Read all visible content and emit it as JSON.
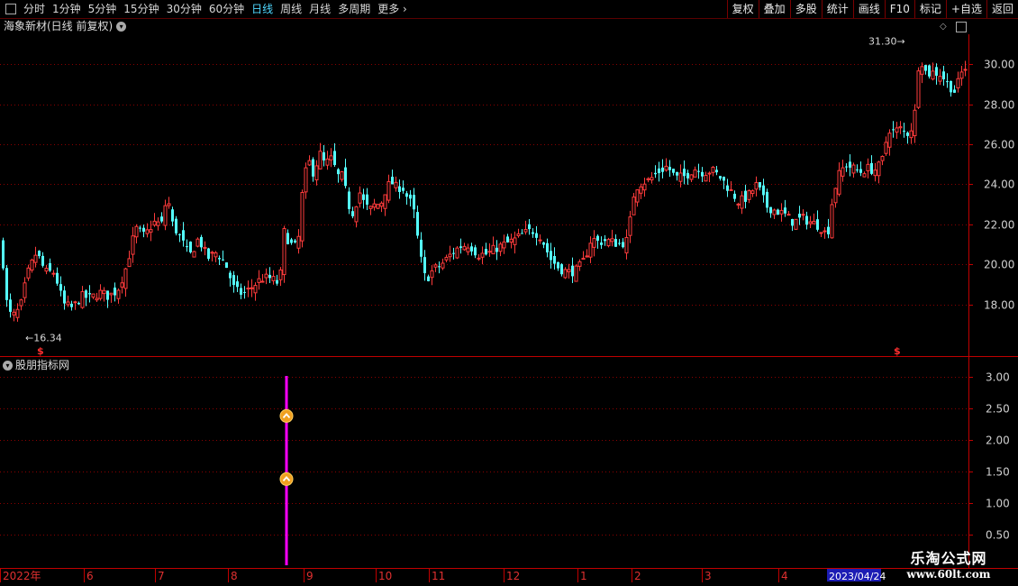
{
  "toolbar": {
    "periods": [
      "分时",
      "1分钟",
      "5分钟",
      "15分钟",
      "30分钟",
      "60分钟",
      "日线",
      "周线",
      "月线",
      "多周期",
      "更多"
    ],
    "active_period": "日线",
    "buttons": [
      "复权",
      "叠加",
      "多股",
      "统计",
      "画线",
      "F10",
      "标记",
      "+自选",
      "返回"
    ]
  },
  "stock_title": "海象新材(日线 前复权)",
  "indicator_title": "股朋指标网",
  "watermark": {
    "line1": "乐淘公式网",
    "line2": "www.60lt.com"
  },
  "colors": {
    "up": "#ff3b3b",
    "down": "#54ffff",
    "grid": "#8b0000",
    "axis": "#c00000",
    "indicator": "#ff00ff"
  },
  "chart_data": [
    {
      "type": "candlestick",
      "title": "海象新材(日线 前复权)",
      "x_labels": [
        "2022年",
        "6",
        "7",
        "8",
        "9",
        "10",
        "11",
        "12",
        "1",
        "2",
        "3",
        "4",
        "2023/04/24"
      ],
      "y_ticks": [
        "18.00",
        "20.00",
        "22.00",
        "24.00",
        "26.00",
        "28.00",
        "30.00"
      ],
      "ylim": [
        16.0,
        31.5
      ],
      "annotations": [
        {
          "text": "16.34",
          "value": 16.34,
          "marker": "←"
        },
        {
          "text": "31.30",
          "value": 31.3,
          "marker": "→"
        }
      ],
      "signal_marks": [
        "$",
        "$"
      ],
      "close_points": [
        [
          0,
          21.4
        ],
        [
          4,
          19.6
        ],
        [
          8,
          17.6
        ],
        [
          14,
          17.4
        ],
        [
          22,
          17.8
        ],
        [
          30,
          19.5
        ],
        [
          40,
          20.6
        ],
        [
          50,
          19.6
        ],
        [
          60,
          19.6
        ],
        [
          70,
          18.0
        ],
        [
          80,
          17.8
        ],
        [
          90,
          18.4
        ],
        [
          100,
          18.3
        ],
        [
          110,
          18.6
        ],
        [
          120,
          18.4
        ],
        [
          130,
          18.7
        ],
        [
          140,
          19.9
        ],
        [
          150,
          21.8
        ],
        [
          160,
          21.4
        ],
        [
          170,
          22.1
        ],
        [
          180,
          22.0
        ],
        [
          185,
          23.6
        ],
        [
          190,
          22.1
        ],
        [
          200,
          21.3
        ],
        [
          210,
          20.4
        ],
        [
          220,
          21.3
        ],
        [
          230,
          20.3
        ],
        [
          240,
          20.6
        ],
        [
          250,
          20.0
        ],
        [
          260,
          18.7
        ],
        [
          270,
          18.5
        ],
        [
          280,
          18.9
        ],
        [
          290,
          19.3
        ],
        [
          300,
          19.3
        ],
        [
          310,
          19.0
        ],
        [
          315,
          21.6
        ],
        [
          322,
          21.0
        ],
        [
          330,
          20.8
        ],
        [
          336,
          24.0
        ],
        [
          342,
          25.2
        ],
        [
          348,
          24.5
        ],
        [
          354,
          25.6
        ],
        [
          360,
          25.0
        ],
        [
          368,
          25.3
        ],
        [
          374,
          24.4
        ],
        [
          380,
          24.4
        ],
        [
          386,
          23.0
        ],
        [
          392,
          22.5
        ],
        [
          398,
          23.7
        ],
        [
          404,
          23.0
        ],
        [
          410,
          22.7
        ],
        [
          416,
          23.0
        ],
        [
          422,
          23.0
        ],
        [
          428,
          23.8
        ],
        [
          434,
          24.1
        ],
        [
          440,
          23.8
        ],
        [
          446,
          23.9
        ],
        [
          452,
          23.3
        ],
        [
          458,
          22.9
        ],
        [
          466,
          20.4
        ],
        [
          472,
          19.2
        ],
        [
          480,
          19.7
        ],
        [
          490,
          20.0
        ],
        [
          500,
          20.5
        ],
        [
          510,
          20.9
        ],
        [
          520,
          21.0
        ],
        [
          530,
          20.5
        ],
        [
          540,
          20.5
        ],
        [
          550,
          20.8
        ],
        [
          560,
          21.0
        ],
        [
          570,
          21.2
        ],
        [
          580,
          21.5
        ],
        [
          590,
          21.7
        ],
        [
          600,
          21.4
        ],
        [
          610,
          20.3
        ],
        [
          620,
          19.8
        ],
        [
          630,
          19.6
        ],
        [
          640,
          19.7
        ],
        [
          648,
          20.2
        ],
        [
          656,
          21.3
        ],
        [
          664,
          21.1
        ],
        [
          672,
          21.2
        ],
        [
          680,
          21.1
        ],
        [
          688,
          21.0
        ],
        [
          696,
          21.2
        ],
        [
          704,
          23.8
        ],
        [
          712,
          24.1
        ],
        [
          720,
          24.2
        ],
        [
          730,
          24.6
        ],
        [
          740,
          24.9
        ],
        [
          750,
          24.3
        ],
        [
          760,
          24.4
        ],
        [
          770,
          24.8
        ],
        [
          780,
          24.6
        ],
        [
          790,
          24.7
        ],
        [
          800,
          24.3
        ],
        [
          810,
          23.7
        ],
        [
          820,
          23.1
        ],
        [
          830,
          23.4
        ],
        [
          840,
          24.0
        ],
        [
          850,
          22.9
        ],
        [
          860,
          22.7
        ],
        [
          870,
          22.5
        ],
        [
          880,
          22.1
        ],
        [
          890,
          22.3
        ],
        [
          900,
          22.1
        ],
        [
          910,
          21.9
        ],
        [
          918,
          21.4
        ],
        [
          924,
          23.4
        ],
        [
          930,
          24.4
        ],
        [
          938,
          25.0
        ],
        [
          946,
          24.8
        ],
        [
          954,
          24.6
        ],
        [
          962,
          24.8
        ],
        [
          970,
          24.7
        ],
        [
          978,
          25.0
        ],
        [
          986,
          26.8
        ],
        [
          992,
          26.6
        ],
        [
          998,
          26.8
        ],
        [
          1006,
          26.5
        ],
        [
          1014,
          27.0
        ],
        [
          1020,
          30.5
        ],
        [
          1028,
          29.5
        ],
        [
          1036,
          29.6
        ],
        [
          1044,
          29.5
        ],
        [
          1052,
          29.0
        ],
        [
          1060,
          28.6
        ],
        [
          1066,
          29.5
        ],
        [
          1072,
          29.9
        ]
      ]
    },
    {
      "type": "bar",
      "title": "股朋指标网",
      "y_ticks": [
        "0.50",
        "1.00",
        "1.50",
        "2.00",
        "2.50",
        "3.00"
      ],
      "ylim": [
        0.0,
        3.2
      ],
      "series": [
        {
          "values": [
            3.0
          ],
          "x_index": 316
        }
      ],
      "signal_icons": [
        {
          "value": 2.38
        },
        {
          "value": 1.38
        }
      ]
    }
  ]
}
